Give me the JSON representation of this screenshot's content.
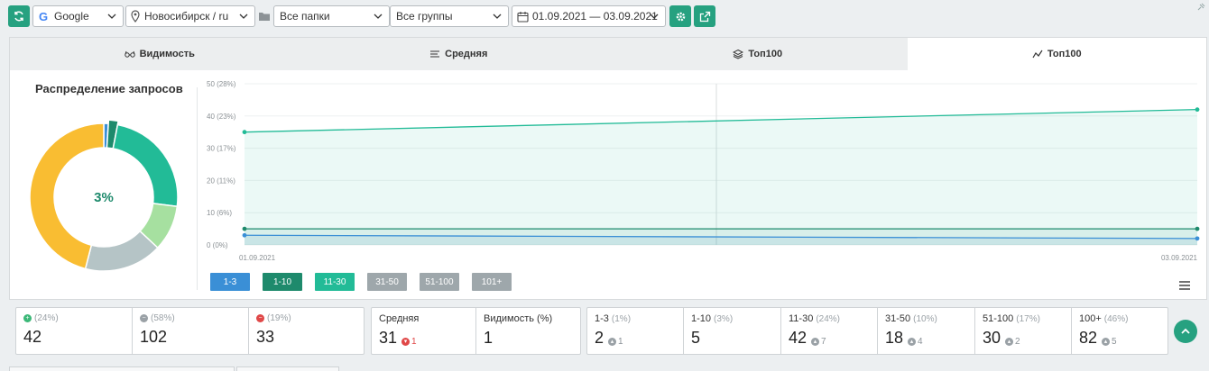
{
  "toolbar": {
    "search_engine": "Google",
    "region": "Новосибирск / ru",
    "folders": "Все папки",
    "groups": "Все группы",
    "date_range": "01.09.2021 — 03.09.2021",
    "accent": "#26a180"
  },
  "tabs": [
    {
      "label": "Видимость",
      "icon": "glasses-icon",
      "active": false
    },
    {
      "label": "Средняя",
      "icon": "lines-icon",
      "active": false
    },
    {
      "label": "Топ100",
      "icon": "layers-icon",
      "active": false
    },
    {
      "label": "Топ100",
      "icon": "trend-icon",
      "active": true
    }
  ],
  "donut": {
    "title": "Распределение запросов",
    "center_label": "3%",
    "segments": [
      {
        "name": "1-3",
        "percent": 1,
        "color": "#3a8fd6"
      },
      {
        "name": "1-10",
        "percent": 2,
        "color": "#1e8a6c"
      },
      {
        "name": "11-30",
        "percent": 24,
        "color": "#22bb97"
      },
      {
        "name": "31-50",
        "percent": 10,
        "color": "#a6e0a0"
      },
      {
        "name": "51-100",
        "percent": 17,
        "color": "#b5c4c6"
      },
      {
        "name": "100+",
        "percent": 46,
        "color": "#f9bd32"
      }
    ]
  },
  "chart_data": {
    "type": "area",
    "x": [
      "01.09.2021",
      "03.09.2021"
    ],
    "ylim": [
      0,
      50
    ],
    "y_ticks": [
      "0 (0%)",
      "10 (6%)",
      "20 (11%)",
      "30 (17%)",
      "40 (23%)",
      "50 (28%)"
    ],
    "x_ticks": [
      "01.09.2021",
      "03.09.2021"
    ],
    "grid": true,
    "series": [
      {
        "name": "1-3",
        "values": [
          3,
          2
        ],
        "color": "#3a8fd6"
      },
      {
        "name": "1-10",
        "values": [
          5,
          5
        ],
        "color": "#1e8a6c"
      },
      {
        "name": "11-30",
        "values": [
          35,
          42
        ],
        "color": "#22bb97"
      },
      {
        "name": "31-50",
        "values": [],
        "color": "#9ea7ab"
      },
      {
        "name": "51-100",
        "values": [],
        "color": "#9ea7ab"
      },
      {
        "name": "101+",
        "values": [],
        "color": "#9ea7ab"
      }
    ]
  },
  "legend": [
    {
      "label": "1-3",
      "color": "#3a8fd6"
    },
    {
      "label": "1-10",
      "color": "#1e8a6c"
    },
    {
      "label": "11-30",
      "color": "#22bb97"
    },
    {
      "label": "31-50",
      "color": "#9ea7ab"
    },
    {
      "label": "51-100",
      "color": "#9ea7ab"
    },
    {
      "label": "101+",
      "color": "#9ea7ab"
    }
  ],
  "stats_group1": [
    {
      "pct": "(24%)",
      "value": "42",
      "icon": "plus-circle-icon",
      "color": "#3cb878"
    },
    {
      "pct": "(58%)",
      "value": "102",
      "icon": "minus-circle-icon",
      "color": "#9aa1a6"
    },
    {
      "pct": "(19%)",
      "value": "33",
      "icon": "minus-circle-icon",
      "color": "#e04848"
    }
  ],
  "stats_group2": [
    {
      "label": "Средняя",
      "value": "31",
      "delta": "1",
      "delta_icon": "down-circle-icon",
      "delta_color": "#e04848"
    },
    {
      "label": "Видимость (%)",
      "value": "1"
    }
  ],
  "stats_group3": [
    {
      "label": "1-3",
      "pct": "(1%)",
      "value": "2",
      "delta": "1",
      "delta_icon": "up-circle-icon"
    },
    {
      "label": "1-10",
      "pct": "(3%)",
      "value": "5"
    },
    {
      "label": "11-30",
      "pct": "(24%)",
      "value": "42",
      "delta": "7",
      "delta_icon": "up-circle-icon"
    },
    {
      "label": "31-50",
      "pct": "(10%)",
      "value": "18",
      "delta": "4",
      "delta_icon": "up-circle-icon"
    },
    {
      "label": "51-100",
      "pct": "(17%)",
      "value": "30",
      "delta": "2",
      "delta_icon": "up-circle-icon"
    },
    {
      "label": "100+",
      "pct": "(46%)",
      "value": "82",
      "delta": "5",
      "delta_icon": "up-circle-icon"
    }
  ]
}
